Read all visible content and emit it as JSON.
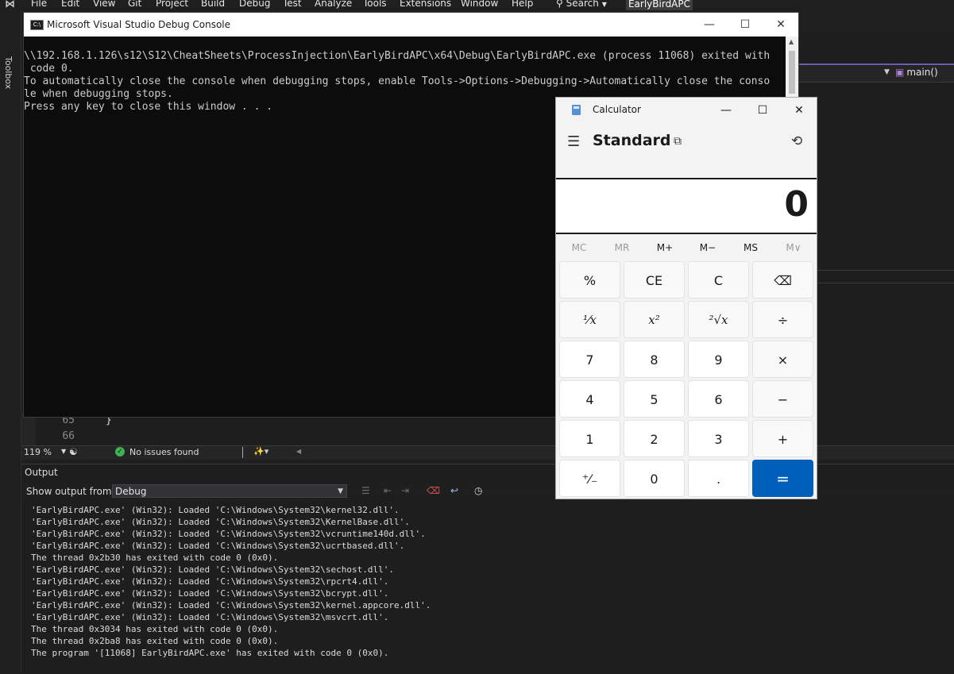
{
  "menubar": {
    "items": [
      "File",
      "Edit",
      "View",
      "Git",
      "Project",
      "Build",
      "Debug",
      "Test",
      "Analyze",
      "Tools",
      "Extensions",
      "Window",
      "Help"
    ],
    "search_label": "Search",
    "solution_name": "EarlyBirdAPC"
  },
  "toolbox": {
    "label": "Toolbox"
  },
  "editor": {
    "nav_member": "main()",
    "line_numbers": [
      "65",
      "66"
    ],
    "brace": "}",
    "status": {
      "zoom": "119 %",
      "issues": "No issues found"
    }
  },
  "output": {
    "title": "Output",
    "show_from_label": "Show output from:",
    "source": "Debug",
    "lines": [
      "'EarlyBirdAPC.exe' (Win32): Loaded 'C:\\Windows\\System32\\kernel32.dll'.",
      "'EarlyBirdAPC.exe' (Win32): Loaded 'C:\\Windows\\System32\\KernelBase.dll'.",
      "'EarlyBirdAPC.exe' (Win32): Loaded 'C:\\Windows\\System32\\vcruntime140d.dll'.",
      "'EarlyBirdAPC.exe' (Win32): Loaded 'C:\\Windows\\System32\\ucrtbased.dll'.",
      "The thread 0x2b30 has exited with code 0 (0x0).",
      "'EarlyBirdAPC.exe' (Win32): Loaded 'C:\\Windows\\System32\\sechost.dll'.",
      "'EarlyBirdAPC.exe' (Win32): Loaded 'C:\\Windows\\System32\\rpcrt4.dll'.",
      "'EarlyBirdAPC.exe' (Win32): Loaded 'C:\\Windows\\System32\\bcrypt.dll'.",
      "'EarlyBirdAPC.exe' (Win32): Loaded 'C:\\Windows\\System32\\kernel.appcore.dll'.",
      "'EarlyBirdAPC.exe' (Win32): Loaded 'C:\\Windows\\System32\\msvcrt.dll'.",
      "The thread 0x3034 has exited with code 0 (0x0).",
      "The thread 0x2ba8 has exited with code 0 (0x0).",
      "The program '[11068] EarlyBirdAPC.exe' has exited with code 0 (0x0)."
    ]
  },
  "console": {
    "title": "Microsoft Visual Studio Debug Console",
    "icon_text": "C:\\",
    "lines": [
      "\\\\192.168.1.126\\s12\\S12\\CheatSheets\\ProcessInjection\\EarlyBirdAPC\\x64\\Debug\\EarlyBirdAPC.exe (process 11068) exited with",
      " code 0.",
      "To automatically close the console when debugging stops, enable Tools->Options->Debugging->Automatically close the conso",
      "le when debugging stops.",
      "Press any key to close this window . . ."
    ]
  },
  "calculator": {
    "title": "Calculator",
    "mode": "Standard",
    "display": "0",
    "memory": [
      "MC",
      "MR",
      "M+",
      "M−",
      "MS",
      "M∨"
    ],
    "keys": [
      [
        "%",
        "CE",
        "C",
        "⌫"
      ],
      [
        "¹⁄x",
        "x²",
        "²√x",
        "÷"
      ],
      [
        "7",
        "8",
        "9",
        "×"
      ],
      [
        "4",
        "5",
        "6",
        "−"
      ],
      [
        "1",
        "2",
        "3",
        "+"
      ],
      [
        "⁺⁄₋",
        "0",
        ".",
        "="
      ]
    ]
  }
}
